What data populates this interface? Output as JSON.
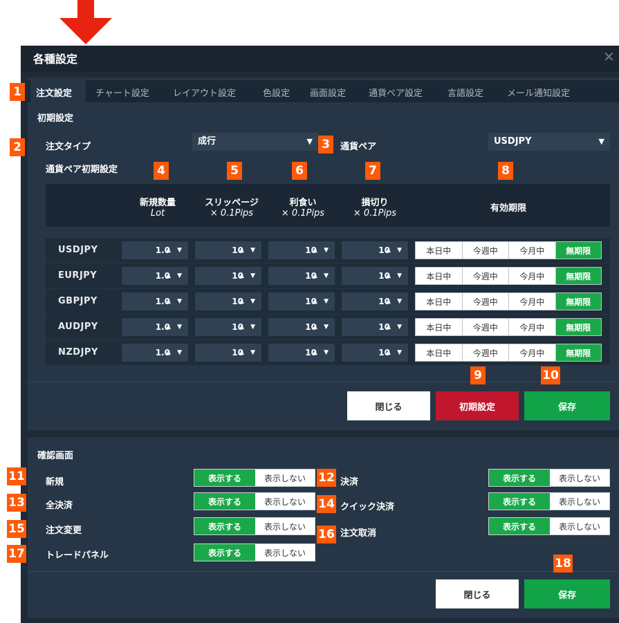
{
  "dialog": {
    "title": "各種設定",
    "close_icon": "close-icon"
  },
  "tabs": [
    "注文設定",
    "チャート設定",
    "レイアウト設定",
    "色設定",
    "画面設定",
    "通貨ペア設定",
    "言語設定",
    "メール通知設定"
  ],
  "initial": {
    "section_title": "初期設定",
    "order_type_label": "注文タイプ",
    "order_type_value": "成行",
    "pair_label": "通貨ペア",
    "pair_value": "USDJPY",
    "pair_initial_label": "通貨ペア初期設定",
    "columns": {
      "lot": "新規数量",
      "lot_unit": "Lot",
      "slip": "スリッページ",
      "slip_unit": "× 0.1Pips",
      "profit": "利食い",
      "profit_unit": "× 0.1Pips",
      "loss": "損切り",
      "loss_unit": "× 0.1Pips",
      "expiry": "有効期限"
    },
    "rows": [
      {
        "pair": "USDJPY",
        "lot": "1.0",
        "slip": "10",
        "profit": "10",
        "loss": "10"
      },
      {
        "pair": "EURJPY",
        "lot": "1.0",
        "slip": "10",
        "profit": "10",
        "loss": "10"
      },
      {
        "pair": "GBPJPY",
        "lot": "1.0",
        "slip": "10",
        "profit": "10",
        "loss": "10"
      },
      {
        "pair": "AUDJPY",
        "lot": "1.0",
        "slip": "10",
        "profit": "10",
        "loss": "10"
      },
      {
        "pair": "NZDJPY",
        "lot": "1.0",
        "slip": "10",
        "profit": "10",
        "loss": "10"
      }
    ],
    "expiry_options": [
      "本日中",
      "今週中",
      "今月中",
      "無期限"
    ],
    "expiry_selected": "無期限",
    "stepper_arrows": "▲ ▼",
    "buttons": {
      "close": "閉じる",
      "reset": "初期設定",
      "save": "保存"
    }
  },
  "confirm": {
    "section_title": "確認画面",
    "on_label": "表示する",
    "off_label": "表示しない",
    "items": [
      "新規",
      "決済",
      "全決済",
      "クイック決済",
      "注文変更",
      "注文取消",
      "トレードパネル"
    ],
    "buttons": {
      "close": "閉じる",
      "save": "保存"
    }
  },
  "callouts": [
    "1",
    "2",
    "3",
    "4",
    "5",
    "6",
    "7",
    "8",
    "9",
    "10",
    "11",
    "12",
    "13",
    "14",
    "15",
    "16",
    "17",
    "18"
  ],
  "colors": {
    "accent_green": "#12a348",
    "accent_red": "#c0172f",
    "callout_orange": "#ff5a0a",
    "arrow_red": "#e8230f"
  }
}
